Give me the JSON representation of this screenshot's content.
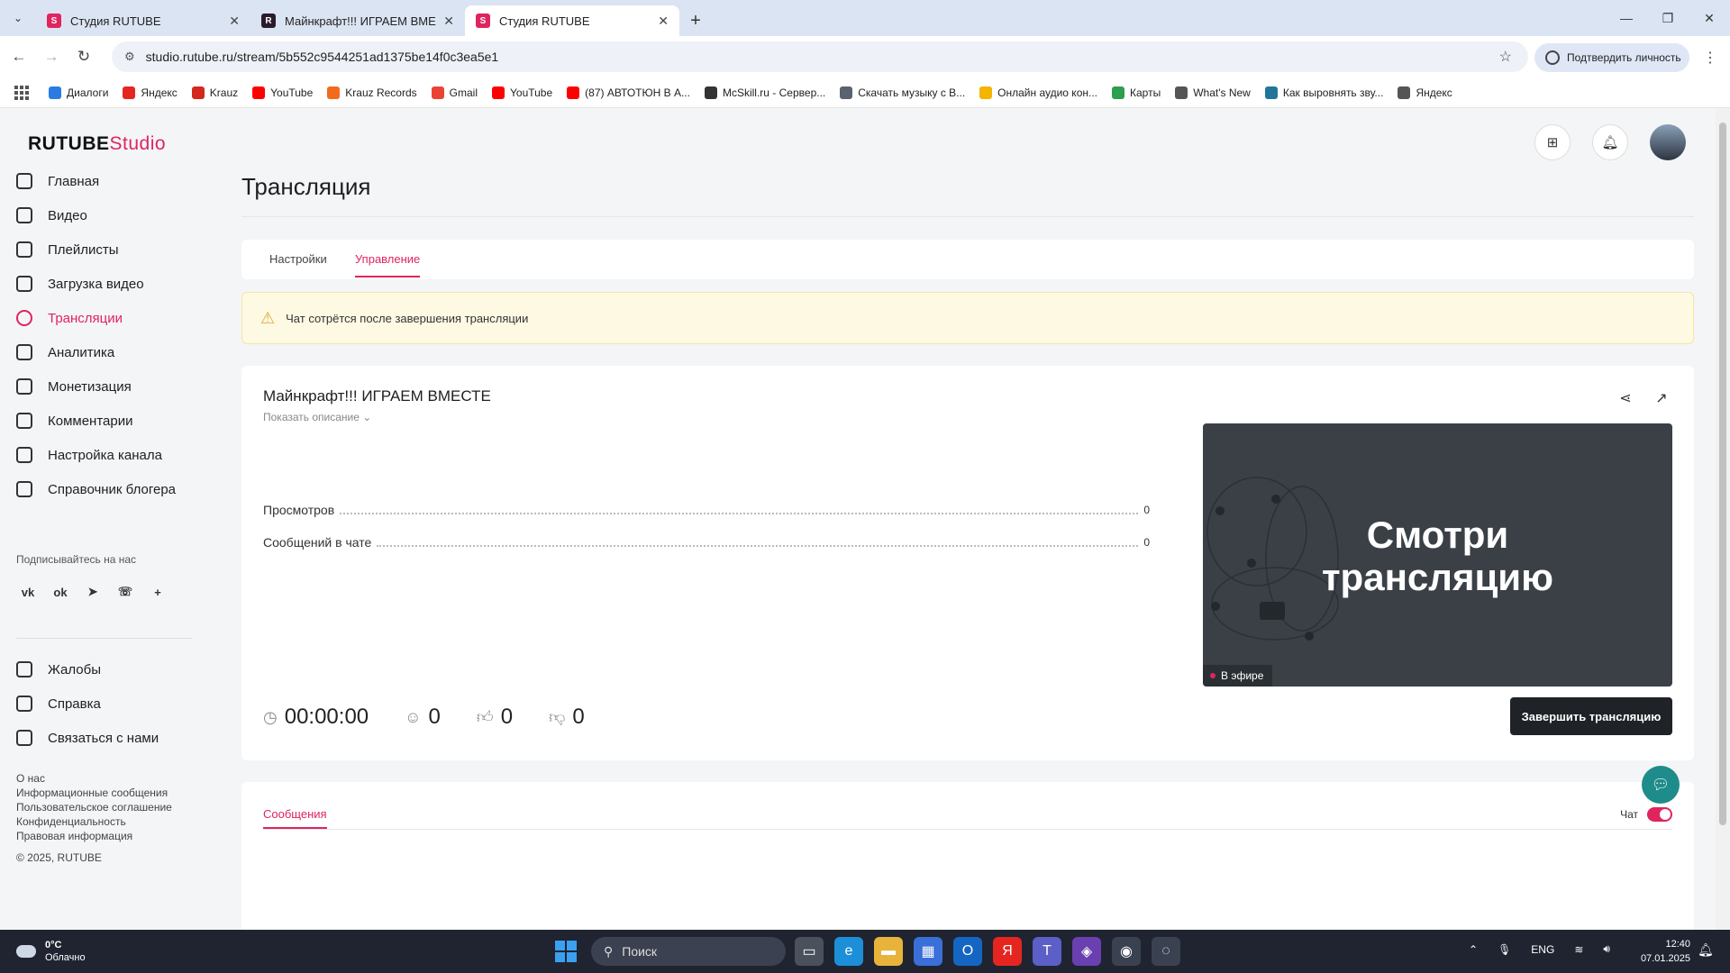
{
  "browser": {
    "tabs": [
      {
        "title": "Студия RUTUBE",
        "favicon": "rutube-studio-icon",
        "active": false
      },
      {
        "title": "Майнкрафт!!! ИГРАЕМ ВМЕСТЕ",
        "favicon": "rutube-icon",
        "active": false
      },
      {
        "title": "Студия RUTUBE",
        "favicon": "rutube-studio-icon",
        "active": true
      }
    ],
    "url": "studio.rutube.ru/stream/5b552c9544251ad1375be14f0c3ea5e1",
    "verify_label": "Подтвердить личность",
    "bookmarks": [
      {
        "label": "Диалоги",
        "color": "#2b7be4"
      },
      {
        "label": "Яндекс",
        "color": "#e52620"
      },
      {
        "label": "Krauz",
        "color": "#d4281c"
      },
      {
        "label": "YouTube",
        "color": "#ff0000"
      },
      {
        "label": "Krauz Records",
        "color": "#f26b1d"
      },
      {
        "label": "Gmail",
        "color": "#ea4335"
      },
      {
        "label": "YouTube",
        "color": "#ff0000"
      },
      {
        "label": "(87) АВТОТЮН В А...",
        "color": "#ff0000"
      },
      {
        "label": "McSkill.ru - Сервер...",
        "color": "#333333"
      },
      {
        "label": "Скачать музыку с В...",
        "color": "#5a6270"
      },
      {
        "label": "Онлайн аудио кон...",
        "color": "#f4b400"
      },
      {
        "label": "Карты",
        "color": "#2e9e4f"
      },
      {
        "label": "What's New",
        "color": "#555555"
      },
      {
        "label": "Как выровнять зву...",
        "color": "#21759b"
      },
      {
        "label": "Яндекс",
        "color": "#555555"
      }
    ]
  },
  "logo": {
    "brand": "RUTUBE",
    "studio": "Studio"
  },
  "sidebar": {
    "items": [
      {
        "label": "Главная",
        "icon": "home-icon",
        "active": false
      },
      {
        "label": "Видео",
        "icon": "video-icon",
        "active": false
      },
      {
        "label": "Плейлисты",
        "icon": "playlist-icon",
        "active": false
      },
      {
        "label": "Загрузка видео",
        "icon": "upload-icon",
        "active": false
      },
      {
        "label": "Трансляции",
        "icon": "broadcast-icon",
        "active": true
      },
      {
        "label": "Аналитика",
        "icon": "analytics-icon",
        "active": false
      },
      {
        "label": "Монетизация",
        "icon": "ruble-icon",
        "active": false
      },
      {
        "label": "Комментарии",
        "icon": "comments-icon",
        "active": false
      },
      {
        "label": "Настройка канала",
        "icon": "settings-icon",
        "active": false
      },
      {
        "label": "Справочник блогера",
        "icon": "book-icon",
        "active": false
      }
    ],
    "follow_label": "Подписывайтесь на нас",
    "socials": [
      "vk-icon",
      "ok-icon",
      "telegram-icon",
      "viber-icon",
      "plus-icon"
    ],
    "secondary": [
      {
        "label": "Жалобы",
        "icon": "flag-icon"
      },
      {
        "label": "Справка",
        "icon": "help-icon"
      },
      {
        "label": "Связаться с нами",
        "icon": "mail-icon"
      }
    ],
    "footer_links": [
      "О нас",
      "Информационные сообщения",
      "Пользовательское соглашение",
      "Конфиденциальность",
      "Правовая информация"
    ],
    "copyright": "© 2025, RUTUBE"
  },
  "main": {
    "title": "Трансляция",
    "tabs": [
      {
        "label": "Настройки",
        "active": false
      },
      {
        "label": "Управление",
        "active": true
      }
    ],
    "warning": "Чат сотрётся после завершения трансляции",
    "stream": {
      "title": "Майнкрафт!!! ИГРАЕМ ВМЕСТЕ",
      "show_description": "Показать описание",
      "stats": [
        {
          "label": "Просмотров",
          "value": "0"
        },
        {
          "label": "Сообщений в чате",
          "value": "0"
        }
      ],
      "preview_text_line1": "Смотри",
      "preview_text_line2": "трансляцию",
      "live_badge": "В эфире",
      "duration": "00:00:00",
      "viewers": "0",
      "likes": "0",
      "dislikes": "0",
      "end_button": "Завершить трансляцию"
    },
    "chat": {
      "tab": "Сообщения",
      "toggle_label": "Чат",
      "toggle_on": true
    }
  },
  "taskbar": {
    "temperature": "0°C",
    "weather": "Облачно",
    "search_placeholder": "Поиск",
    "language": "ENG",
    "time": "12:40",
    "date": "07.01.2025"
  },
  "colors": {
    "accent": "#e0245e",
    "warning_bg": "#fdf9e3",
    "dark_button": "#1f2328"
  }
}
